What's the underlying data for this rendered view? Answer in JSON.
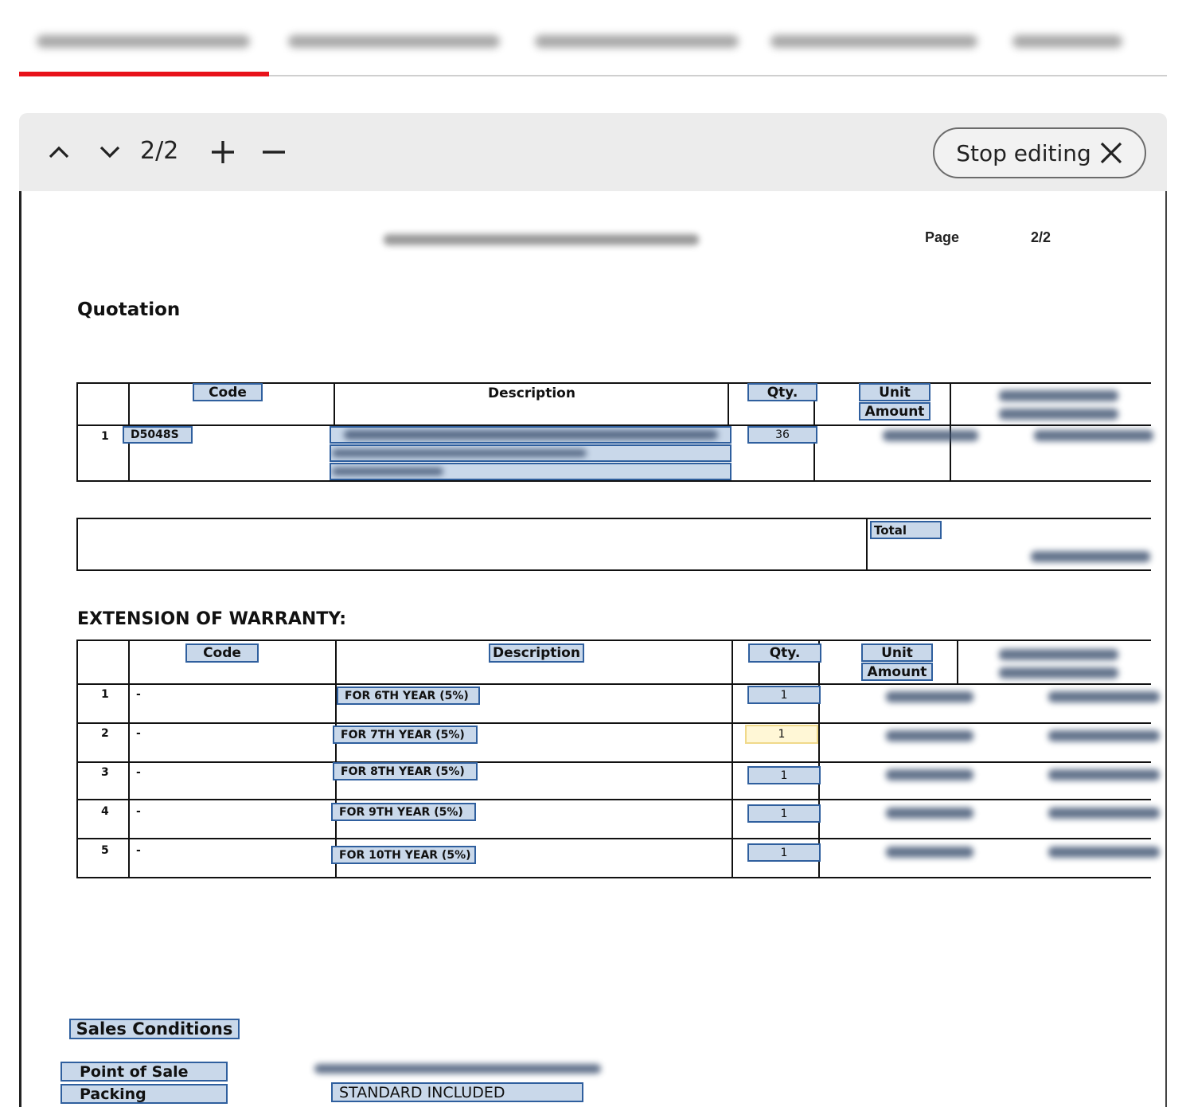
{
  "tabs": [
    {
      "label": ""
    },
    {
      "label": ""
    },
    {
      "label": ""
    },
    {
      "label": ""
    },
    {
      "label": ""
    }
  ],
  "toolbar": {
    "page_indicator": "2/2",
    "stop_label": "Stop editing",
    "icons": [
      "chevron-up-icon",
      "chevron-down-icon",
      "plus-icon",
      "minus-icon",
      "close-icon"
    ]
  },
  "doc": {
    "page_label": "Page",
    "page_value": "2/2",
    "heading": "Quotation",
    "quote_table": {
      "headers": {
        "code": "Code",
        "description": "Description",
        "qty": "Qty.",
        "unit": "Unit",
        "amount": "Amount"
      },
      "rows": [
        {
          "num": "1",
          "code": "D5048S",
          "qty": "36"
        }
      ]
    },
    "total_label": "Total",
    "warranty_title": "EXTENSION OF WARRANTY:",
    "warranty_table": {
      "headers": {
        "code": "Code",
        "description": "Description",
        "qty": "Qty.",
        "unit": "Unit",
        "amount": "Amount"
      },
      "rows": [
        {
          "num": "1",
          "code": "-",
          "description": "FOR 6TH YEAR (5%)",
          "qty": "1"
        },
        {
          "num": "2",
          "code": "-",
          "description": "FOR 7TH YEAR (5%)",
          "qty": "1"
        },
        {
          "num": "3",
          "code": "-",
          "description": "FOR 8TH YEAR (5%)",
          "qty": "1"
        },
        {
          "num": "4",
          "code": "-",
          "description": "FOR 9TH YEAR (5%)",
          "qty": "1"
        },
        {
          "num": "5",
          "code": "-",
          "description": "FOR 10TH YEAR (5%)",
          "qty": "1"
        }
      ]
    },
    "sales_conditions": {
      "title": "Sales Conditions",
      "point_of_sale_label": "Point of Sale",
      "packing_label": "Packing",
      "packing_value": "STANDARD INCLUDED"
    }
  }
}
